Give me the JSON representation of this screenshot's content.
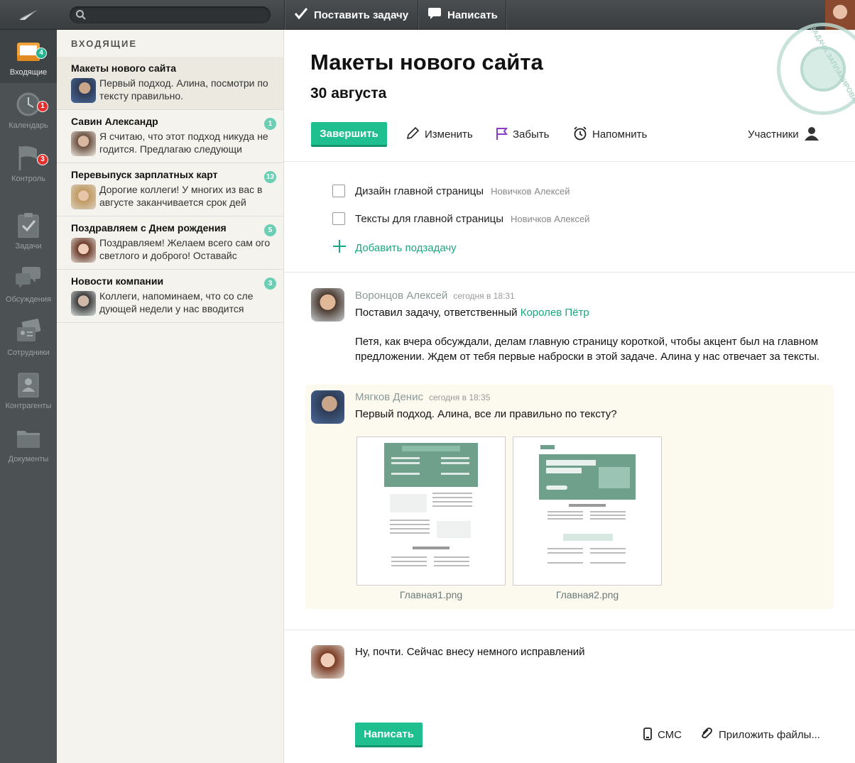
{
  "topbar": {
    "search_placeholder": "",
    "new_task_label": "Поставить задачу",
    "write_label": "Написать"
  },
  "nav": {
    "items": [
      {
        "label": "Входящие",
        "badge": "4"
      },
      {
        "label": "Календарь",
        "badge": "1"
      },
      {
        "label": "Контроль",
        "badge": "3"
      },
      {
        "label": "Задачи"
      },
      {
        "label": "Обсуждения"
      },
      {
        "label": "Сотрудники"
      },
      {
        "label": "Контрагенты"
      },
      {
        "label": "Документы"
      }
    ]
  },
  "inbox": {
    "title": "ВХОДЯЩИЕ",
    "items": [
      {
        "title": "Макеты нового сайта",
        "text": "Первый подход. Алина, посмотри по тексту правильно.",
        "count": ""
      },
      {
        "title": "Савин Александр",
        "text": "Я считаю, что этот подход никуда не годится. Предлагаю следующи",
        "count": "1"
      },
      {
        "title": "Перевыпуск зарплатных карт",
        "text": "Дорогие коллеги! У многих из вас в августе заканчивается срок дей",
        "count": "13"
      },
      {
        "title": "Поздравляем с Днем рождения",
        "text": "Поздравляем! Желаем всего сам ого светлого и доброго! Оставайс",
        "count": "5"
      },
      {
        "title": "Новости компании",
        "text": "Коллеги, напоминаем, что со сле дующей недели у нас вводится",
        "count": "3"
      }
    ]
  },
  "task": {
    "title": "Макеты нового сайта",
    "date": "30 августа",
    "finish_label": "Завершить",
    "edit_label": "Изменить",
    "forget_label": "Забыть",
    "remind_label": "Напомнить",
    "participants_label": "Участники",
    "stamp_text": "ЗАДАЧА ЗАПЛАНИРОВАНА",
    "subtasks": [
      {
        "label": "Дизайн главной страницы",
        "assignee": "Новичков Алексей"
      },
      {
        "label": "Тексты для главной страницы",
        "assignee": "Новичков Алексей"
      }
    ],
    "add_subtask_label": "Добавить подзадачу"
  },
  "comments": [
    {
      "author": "Воронцов Алексей",
      "time": "сегодня в 18:31",
      "line1_prefix": "Поставил задачу, ответственный",
      "line1_link": "Королев Пётр",
      "body": "Петя, как вчера обсуждали, делам главную страницу короткой, чтобы акцент был на главном предложении. Ждем от тебя первые наброски в этой задаче. Алина у нас отвечает за тексты."
    },
    {
      "author": "Мягков Денис",
      "time": "сегодня в 18:35",
      "body": "Первый подход. Алина, все ли правильно по тексту?",
      "attachments": [
        "Главная1.png",
        "Главная2.png"
      ]
    }
  ],
  "reply": {
    "text": "Ну, почти. Сейчас внесу немного исправлений",
    "send_label": "Написать",
    "sms_label": "СМС",
    "attach_label": "Приложить файлы..."
  },
  "colors": {
    "accent": "#1fbf8f",
    "nav_bg": "#4c5254",
    "badge_red": "#e2312f",
    "link": "#18a782"
  }
}
